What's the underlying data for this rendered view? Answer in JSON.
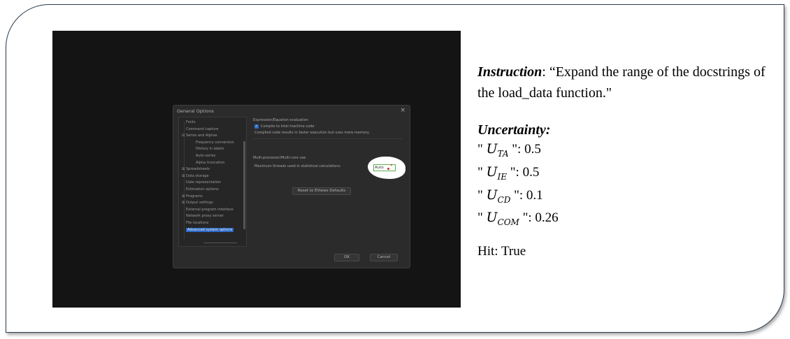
{
  "dialog": {
    "title": "General Options",
    "close_glyph": "×",
    "tree_items": [
      {
        "label": "Fonts",
        "indent": 0
      },
      {
        "label": "Command capture",
        "indent": 0
      },
      {
        "label": "Series and Alphas",
        "indent": 0,
        "expander": "⊟"
      },
      {
        "label": "Frequency conversion",
        "indent": 1
      },
      {
        "label": "History in labels",
        "indent": 1
      },
      {
        "label": "Auto-series",
        "indent": 1
      },
      {
        "label": "Alpha truncation",
        "indent": 1
      },
      {
        "label": "Spreadsheets",
        "indent": 0,
        "expander": "⊞"
      },
      {
        "label": "Data storage",
        "indent": 0,
        "expander": "⊞"
      },
      {
        "label": "Date representation",
        "indent": 0
      },
      {
        "label": "Estimation options",
        "indent": 0
      },
      {
        "label": "Programs",
        "indent": 0,
        "expander": "⊞"
      },
      {
        "label": "Output settings",
        "indent": 0,
        "expander": "⊞"
      },
      {
        "label": "External program interface",
        "indent": 0
      },
      {
        "label": "Network proxy server",
        "indent": 0
      },
      {
        "label": "File locations",
        "indent": 0
      },
      {
        "label": "Advanced system options",
        "indent": 0,
        "selected": true
      }
    ],
    "expr_section": "Expression/Equation evaluation",
    "compile_label": "Compile to Intel machine code",
    "compile_checked": true,
    "compile_note": "Compiled code results in faster execution but uses more memory.",
    "multi_section": "Multi-processor/Multi-core use",
    "threads_label": "Maximum threads used in statistical calculations:",
    "threads_value": "Auto",
    "reset_button": "Reset to EViews Defaults",
    "ok_button": "OK",
    "cancel_button": "Cancel"
  },
  "panel": {
    "instruction_label": "Instruction",
    "instruction_text": ": “Expand the range of the docstrings of the load_data function.\"",
    "uncertainty_title": "Uncertainty:",
    "metrics": [
      {
        "symbol": "U",
        "sub": "TA",
        "value": "0.5"
      },
      {
        "symbol": "U",
        "sub": "IE",
        "value": "0.5"
      },
      {
        "symbol": "U",
        "sub": "CD",
        "value": "0.1"
      },
      {
        "symbol": "U",
        "sub": "COM",
        "value": "0.26"
      }
    ],
    "hit": "Hit: True"
  }
}
